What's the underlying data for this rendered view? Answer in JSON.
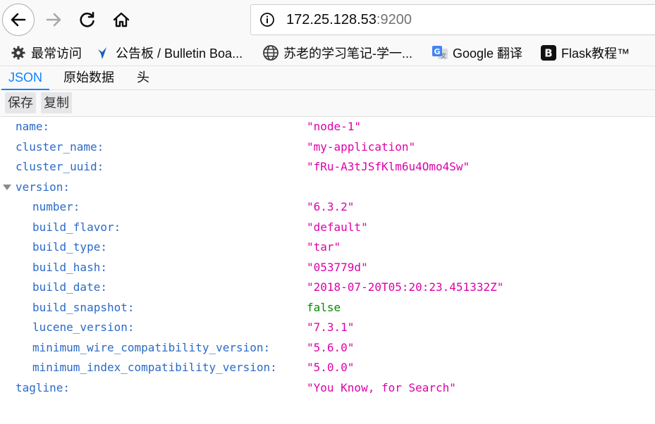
{
  "browser": {
    "url_host": "172.25.128.53",
    "url_port": ":9200",
    "icons": {
      "back": "back-arrow-icon",
      "forward": "forward-arrow-icon",
      "reload": "reload-icon",
      "home": "home-icon",
      "info": "site-info-icon"
    }
  },
  "bookmarks": [
    {
      "label": "最常访问",
      "icon": "gear-icon"
    },
    {
      "label": "公告板 / Bulletin Boa...",
      "icon": "bulletin-icon"
    },
    {
      "label": "苏老的学习笔记-学一...",
      "icon": "globe-icon"
    },
    {
      "label": "Google 翻译",
      "icon": "google-translate-icon"
    },
    {
      "label": "Flask教程™",
      "icon": "flask-b-icon"
    }
  ],
  "viewer": {
    "tabs": [
      "JSON",
      "原始数据",
      "头"
    ],
    "active_tab": "JSON",
    "actions": [
      "保存",
      "复制"
    ]
  },
  "json": {
    "rows": [
      {
        "key": "name:",
        "value": "\"node-1\"",
        "type": "string",
        "depth": 0
      },
      {
        "key": "cluster_name:",
        "value": "\"my-application\"",
        "type": "string",
        "depth": 0
      },
      {
        "key": "cluster_uuid:",
        "value": "\"fRu-A3tJSfKlm6u4Omo4Sw\"",
        "type": "string",
        "depth": 0
      },
      {
        "key": "version:",
        "value": "",
        "type": "object",
        "depth": 0,
        "expanded": true
      },
      {
        "key": "number:",
        "value": "\"6.3.2\"",
        "type": "string",
        "depth": 1
      },
      {
        "key": "build_flavor:",
        "value": "\"default\"",
        "type": "string",
        "depth": 1
      },
      {
        "key": "build_type:",
        "value": "\"tar\"",
        "type": "string",
        "depth": 1
      },
      {
        "key": "build_hash:",
        "value": "\"053779d\"",
        "type": "string",
        "depth": 1
      },
      {
        "key": "build_date:",
        "value": "\"2018-07-20T05:20:23.451332Z\"",
        "type": "string",
        "depth": 1
      },
      {
        "key": "build_snapshot:",
        "value": "false",
        "type": "boolean",
        "depth": 1
      },
      {
        "key": "lucene_version:",
        "value": "\"7.3.1\"",
        "type": "string",
        "depth": 1
      },
      {
        "key": "minimum_wire_compatibility_version:",
        "value": "\"5.6.0\"",
        "type": "string",
        "depth": 1
      },
      {
        "key": "minimum_index_compatibility_version:",
        "value": "\"5.0.0\"",
        "type": "string",
        "depth": 1
      },
      {
        "key": "tagline:",
        "value": "\"You Know, for Search\"",
        "type": "string",
        "depth": 0
      }
    ]
  },
  "colors": {
    "key": "#2b6ac7",
    "string": "#dd00a9",
    "boolean": "#058b00",
    "accent": "#0a84ff"
  }
}
